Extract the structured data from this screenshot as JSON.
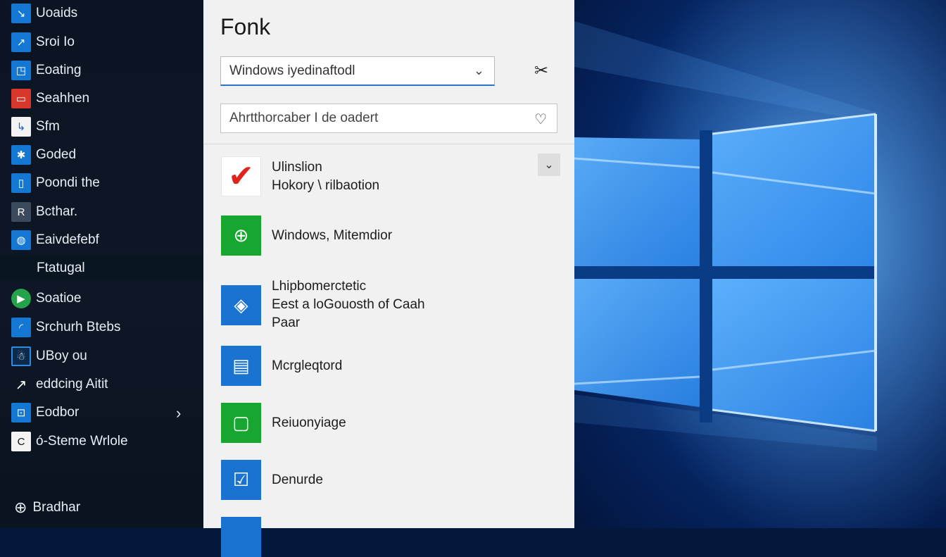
{
  "start_menu": {
    "items": [
      {
        "label": "Uoaids",
        "icon": "↘"
      },
      {
        "label": "Sroi Io",
        "icon": "↗"
      },
      {
        "label": "Eoating",
        "icon": "◳"
      },
      {
        "label": "Seahhen",
        "icon": "▭"
      },
      {
        "label": "Sfm",
        "icon": "↳"
      },
      {
        "label": "Goded",
        "icon": "✱"
      },
      {
        "label": "Poondi the",
        "icon": "▯"
      },
      {
        "label": "Bcthar.",
        "icon": "R"
      },
      {
        "label": "Eaivdefebf",
        "icon": "◍"
      },
      {
        "label": "Soatioe",
        "icon": "▶"
      },
      {
        "label": "Srchurh Btebs",
        "icon": "◜"
      },
      {
        "label": "UBoy ou",
        "icon": "☃"
      },
      {
        "label": "eddcing Aitit",
        "icon": "↗"
      },
      {
        "label": "Eodbor",
        "icon": "⊡"
      },
      {
        "label": "ó-Steme Wrlole",
        "icon": "C"
      }
    ],
    "subheader": "Ftatugal",
    "chevron": "›",
    "bottom": {
      "label": "Bradhar",
      "icon": "⊕"
    }
  },
  "panel": {
    "title": "Fonk",
    "dropdown": {
      "value": "Windows iyedinaftodl",
      "chevron": "⌄"
    },
    "tool_icon": "✂",
    "search": {
      "value": "Ahrtthorcaber I de oadert",
      "icon": "♡"
    },
    "expand_icon": "⌄",
    "list": [
      {
        "line1": "Ulinslion",
        "line2": "Hokory \\ rilbaotion",
        "icon": "✔"
      },
      {
        "line1": "Windows, Mitemdior",
        "line2": "",
        "icon": "⊕"
      },
      {
        "line1": "Lhipbomerctetic",
        "line2": "Eest a loGouosth of Caah",
        "line3": "Paar",
        "icon": "◈"
      },
      {
        "line1": "Mcrgleqtord",
        "line2": "",
        "icon": "▤"
      },
      {
        "line1": "Reiuonyiage",
        "line2": "",
        "icon": "▢"
      },
      {
        "line1": "Denurde",
        "line2": "",
        "icon": "☑"
      },
      {
        "line1": "",
        "line2": "",
        "icon": ""
      }
    ]
  },
  "colors": {
    "menu_bg": "#0d1726",
    "panel_bg": "#f1f1f1",
    "accent_blue": "#1b73d1",
    "accent_green": "#17a62f",
    "wallpaper_blue": "#1f6fce"
  }
}
